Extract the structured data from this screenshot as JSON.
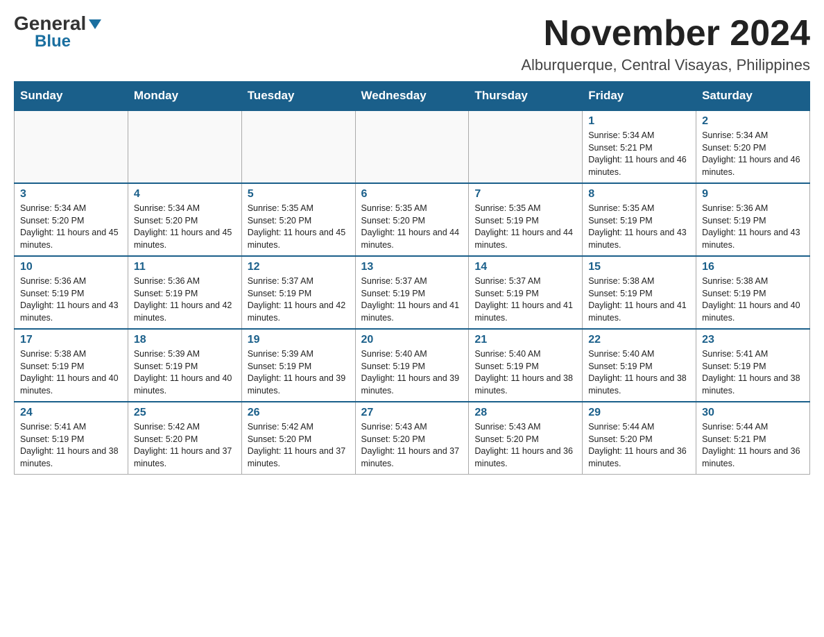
{
  "logo": {
    "general": "General",
    "triangle": "▶",
    "blue": "Blue"
  },
  "title": "November 2024",
  "location": "Alburquerque, Central Visayas, Philippines",
  "days_of_week": [
    "Sunday",
    "Monday",
    "Tuesday",
    "Wednesday",
    "Thursday",
    "Friday",
    "Saturday"
  ],
  "weeks": [
    [
      {
        "day": "",
        "info": ""
      },
      {
        "day": "",
        "info": ""
      },
      {
        "day": "",
        "info": ""
      },
      {
        "day": "",
        "info": ""
      },
      {
        "day": "",
        "info": ""
      },
      {
        "day": "1",
        "info": "Sunrise: 5:34 AM\nSunset: 5:21 PM\nDaylight: 11 hours and 46 minutes."
      },
      {
        "day": "2",
        "info": "Sunrise: 5:34 AM\nSunset: 5:20 PM\nDaylight: 11 hours and 46 minutes."
      }
    ],
    [
      {
        "day": "3",
        "info": "Sunrise: 5:34 AM\nSunset: 5:20 PM\nDaylight: 11 hours and 45 minutes."
      },
      {
        "day": "4",
        "info": "Sunrise: 5:34 AM\nSunset: 5:20 PM\nDaylight: 11 hours and 45 minutes."
      },
      {
        "day": "5",
        "info": "Sunrise: 5:35 AM\nSunset: 5:20 PM\nDaylight: 11 hours and 45 minutes."
      },
      {
        "day": "6",
        "info": "Sunrise: 5:35 AM\nSunset: 5:20 PM\nDaylight: 11 hours and 44 minutes."
      },
      {
        "day": "7",
        "info": "Sunrise: 5:35 AM\nSunset: 5:19 PM\nDaylight: 11 hours and 44 minutes."
      },
      {
        "day": "8",
        "info": "Sunrise: 5:35 AM\nSunset: 5:19 PM\nDaylight: 11 hours and 43 minutes."
      },
      {
        "day": "9",
        "info": "Sunrise: 5:36 AM\nSunset: 5:19 PM\nDaylight: 11 hours and 43 minutes."
      }
    ],
    [
      {
        "day": "10",
        "info": "Sunrise: 5:36 AM\nSunset: 5:19 PM\nDaylight: 11 hours and 43 minutes."
      },
      {
        "day": "11",
        "info": "Sunrise: 5:36 AM\nSunset: 5:19 PM\nDaylight: 11 hours and 42 minutes."
      },
      {
        "day": "12",
        "info": "Sunrise: 5:37 AM\nSunset: 5:19 PM\nDaylight: 11 hours and 42 minutes."
      },
      {
        "day": "13",
        "info": "Sunrise: 5:37 AM\nSunset: 5:19 PM\nDaylight: 11 hours and 41 minutes."
      },
      {
        "day": "14",
        "info": "Sunrise: 5:37 AM\nSunset: 5:19 PM\nDaylight: 11 hours and 41 minutes."
      },
      {
        "day": "15",
        "info": "Sunrise: 5:38 AM\nSunset: 5:19 PM\nDaylight: 11 hours and 41 minutes."
      },
      {
        "day": "16",
        "info": "Sunrise: 5:38 AM\nSunset: 5:19 PM\nDaylight: 11 hours and 40 minutes."
      }
    ],
    [
      {
        "day": "17",
        "info": "Sunrise: 5:38 AM\nSunset: 5:19 PM\nDaylight: 11 hours and 40 minutes."
      },
      {
        "day": "18",
        "info": "Sunrise: 5:39 AM\nSunset: 5:19 PM\nDaylight: 11 hours and 40 minutes."
      },
      {
        "day": "19",
        "info": "Sunrise: 5:39 AM\nSunset: 5:19 PM\nDaylight: 11 hours and 39 minutes."
      },
      {
        "day": "20",
        "info": "Sunrise: 5:40 AM\nSunset: 5:19 PM\nDaylight: 11 hours and 39 minutes."
      },
      {
        "day": "21",
        "info": "Sunrise: 5:40 AM\nSunset: 5:19 PM\nDaylight: 11 hours and 38 minutes."
      },
      {
        "day": "22",
        "info": "Sunrise: 5:40 AM\nSunset: 5:19 PM\nDaylight: 11 hours and 38 minutes."
      },
      {
        "day": "23",
        "info": "Sunrise: 5:41 AM\nSunset: 5:19 PM\nDaylight: 11 hours and 38 minutes."
      }
    ],
    [
      {
        "day": "24",
        "info": "Sunrise: 5:41 AM\nSunset: 5:19 PM\nDaylight: 11 hours and 38 minutes."
      },
      {
        "day": "25",
        "info": "Sunrise: 5:42 AM\nSunset: 5:20 PM\nDaylight: 11 hours and 37 minutes."
      },
      {
        "day": "26",
        "info": "Sunrise: 5:42 AM\nSunset: 5:20 PM\nDaylight: 11 hours and 37 minutes."
      },
      {
        "day": "27",
        "info": "Sunrise: 5:43 AM\nSunset: 5:20 PM\nDaylight: 11 hours and 37 minutes."
      },
      {
        "day": "28",
        "info": "Sunrise: 5:43 AM\nSunset: 5:20 PM\nDaylight: 11 hours and 36 minutes."
      },
      {
        "day": "29",
        "info": "Sunrise: 5:44 AM\nSunset: 5:20 PM\nDaylight: 11 hours and 36 minutes."
      },
      {
        "day": "30",
        "info": "Sunrise: 5:44 AM\nSunset: 5:21 PM\nDaylight: 11 hours and 36 minutes."
      }
    ]
  ]
}
